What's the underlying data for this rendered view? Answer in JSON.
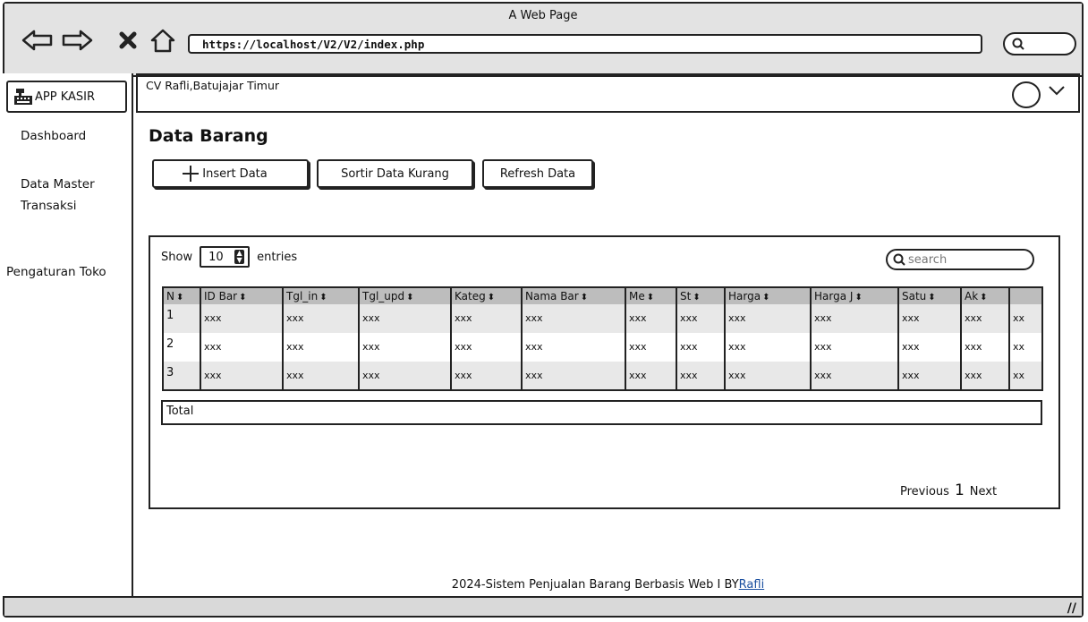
{
  "window": {
    "title": "A Web Page",
    "url": "https://localhost/V2/V2/index.php"
  },
  "sidebar": {
    "brand": "APP KASIR",
    "items": [
      {
        "label": "Dashboard"
      },
      {
        "label": "Data Master"
      },
      {
        "label": "Transaksi"
      },
      {
        "label": "Pengaturan Toko"
      }
    ]
  },
  "topbar": {
    "company": "CV Rafli,Batujajar Timur"
  },
  "main": {
    "title": "Data Barang",
    "buttons": {
      "insert": "Insert Data",
      "sort": "Sortir Data Kurang",
      "refresh": "Refresh Data"
    },
    "show_label": "Show",
    "entries_value": "10",
    "entries_label": "entries",
    "search_placeholder": "search",
    "table": {
      "columns": [
        "N",
        "ID Bar",
        "Tgl_in",
        "Tgl_upd",
        "Kateg",
        "Nama Bar",
        "Me",
        "St",
        "Harga",
        "Harga J",
        "Satu",
        "Ak",
        ""
      ],
      "rows": [
        [
          "1",
          "xxx",
          "xxx",
          "xxx",
          "xxx",
          "xxx",
          "xxx",
          "xxx",
          "xxx",
          "xxx",
          "xxx",
          "xxx",
          "xx"
        ],
        [
          "2",
          "xxx",
          "xxx",
          "xxx",
          "xxx",
          "xxx",
          "xxx",
          "xxx",
          "xxx",
          "xxx",
          "xxx",
          "xxx",
          "xx"
        ],
        [
          "3",
          "xxx",
          "xxx",
          "xxx",
          "xxx",
          "xxx",
          "xxx",
          "xxx",
          "xxx",
          "xxx",
          "xxx",
          "xxx",
          "xx"
        ]
      ],
      "total_label": "Total"
    },
    "pager": {
      "previous": "Previous",
      "page": "1",
      "next": "Next"
    }
  },
  "footer": {
    "text": "2024-Sistem Penjualan Barang Berbasis Web I BY",
    "link": "Rafli"
  }
}
